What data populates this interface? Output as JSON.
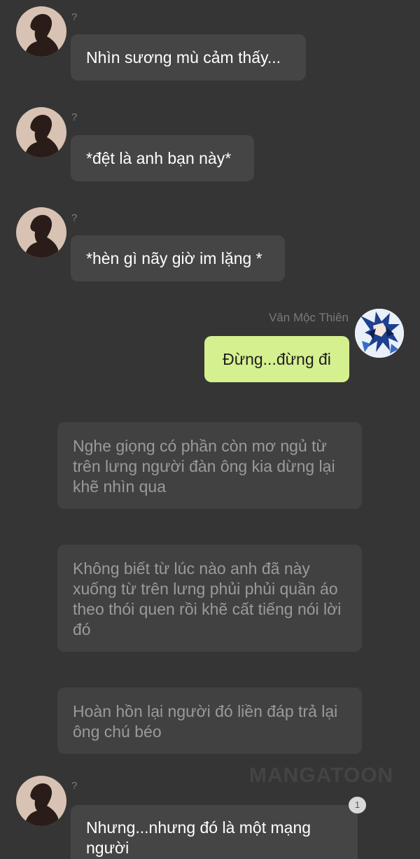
{
  "messages": [
    {
      "sender": "?",
      "text": "Nhìn sương mù cảm thấy..."
    },
    {
      "sender": "?",
      "text": "*đệt là anh bạn này*"
    },
    {
      "sender": "?",
      "text": "*hèn gì nãy giờ im lặng *"
    },
    {
      "sender": "Vân Mộc Thiên",
      "text": "Đừng...đừng đi"
    },
    {
      "sender": "?",
      "text": "Nhưng...nhưng đó là một mạng người"
    }
  ],
  "narrations": [
    "Nghe giọng có phần còn mơ ngủ từ trên lưng người đàn ông kia dừng lại khẽ nhìn qua",
    "Không biết từ lúc nào anh đã này xuống từ trên lưng phủi phủi quần áo theo thói quen rồi khẽ cất tiếng nói lời đó",
    "Hoàn hồn lại người đó liền đáp trả lại ông chú béo"
  ],
  "watermark": "MANGATOON",
  "unread_badge": "1",
  "colors": {
    "background": "#353535",
    "bubble_left": "#454545",
    "bubble_right": "#d5f08f",
    "narration": "#414141",
    "avatar_bg": "#d8c2b3",
    "silhouette": "#2a1c18"
  }
}
